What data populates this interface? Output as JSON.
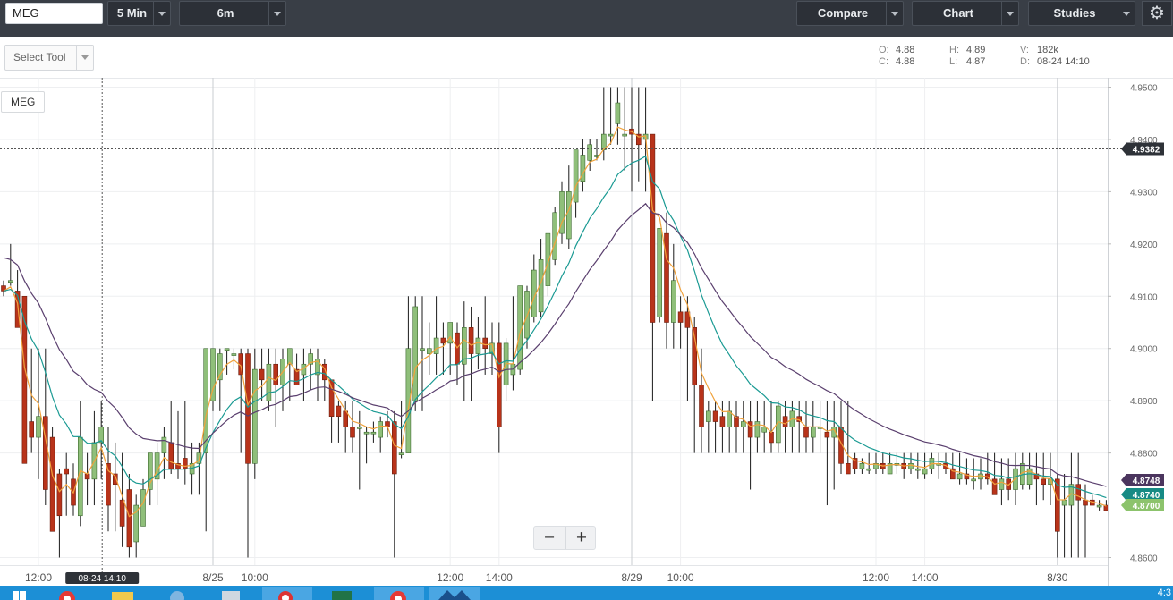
{
  "toolbar": {
    "symbol_value": "MEG",
    "interval": "5 Min",
    "range": "6m",
    "compare": "Compare",
    "chart": "Chart",
    "studies": "Studies",
    "settings_icon": "gear-icon"
  },
  "subbar": {
    "select_tool": "Select Tool",
    "ohlc": {
      "o_label": "O:",
      "o": "4.88",
      "c_label": "C:",
      "c": "4.88",
      "h_label": "H:",
      "h": "4.89",
      "l_label": "L:",
      "l": "4.87",
      "v_label": "V:",
      "v": "182k",
      "d_label": "D:",
      "d": "08-24 14:10"
    }
  },
  "chart_symbol": "MEG",
  "zoom": {
    "minus": "−",
    "plus": "+"
  },
  "taskbar": {
    "clock": "4:3"
  },
  "colors": {
    "up": "#8fbf7a",
    "down": "#b8331a",
    "ema_fast": "#f0a23c",
    "ema_mid": "#1a9a93",
    "ema_slow": "#5a3f6e",
    "crosshair_label": "#2e3238"
  },
  "chart_data": {
    "type": "candlestick",
    "ylim": [
      4.858,
      4.952
    ],
    "y_ticks": [
      "4.9500",
      "4.9400",
      "4.9300",
      "4.9200",
      "4.9100",
      "4.9000",
      "4.8900",
      "4.8800",
      "4.8600"
    ],
    "x_ticks": [
      {
        "i": 5,
        "label": "12:00"
      },
      {
        "i": 30,
        "label": "8/25"
      },
      {
        "i": 36,
        "label": "10:00"
      },
      {
        "i": 64,
        "label": "12:00"
      },
      {
        "i": 71,
        "label": "14:00"
      },
      {
        "i": 90,
        "label": "8/29"
      },
      {
        "i": 97,
        "label": "10:00"
      },
      {
        "i": 125,
        "label": "12:00"
      },
      {
        "i": 132,
        "label": "14:00"
      },
      {
        "i": 151,
        "label": "8/30"
      }
    ],
    "crosshair": {
      "i": 14,
      "date_label": "08-24 14:10",
      "price": 4.9382,
      "price_label": "4.9382"
    },
    "last_values": [
      {
        "label": "4.8748",
        "value": 4.8748,
        "color": "#4b355e"
      },
      {
        "label": "4.8740",
        "value": 4.873,
        "color": "#178a84"
      },
      {
        "label": "4.8700",
        "value": 4.87,
        "color": "#8cc36c"
      }
    ],
    "candles": [
      [
        4.912,
        4.913,
        4.91,
        4.911
      ],
      [
        4.913,
        4.92,
        4.912,
        4.913
      ],
      [
        4.911,
        4.915,
        4.905,
        4.904
      ],
      [
        4.91,
        4.91,
        4.878,
        4.878
      ],
      [
        4.886,
        4.9,
        4.88,
        4.883
      ],
      [
        4.883,
        4.9,
        4.875,
        4.887
      ],
      [
        4.887,
        4.9,
        4.87,
        4.873
      ],
      [
        4.883,
        4.885,
        4.868,
        4.865
      ],
      [
        4.876,
        4.877,
        4.86,
        4.868
      ],
      [
        4.877,
        4.88,
        4.868,
        4.876
      ],
      [
        4.875,
        4.878,
        4.868,
        4.87
      ],
      [
        4.868,
        4.89,
        4.866,
        4.883
      ],
      [
        4.876,
        4.88,
        4.87,
        4.875
      ],
      [
        4.875,
        4.888,
        4.87,
        4.882
      ],
      [
        4.882,
        4.89,
        4.875,
        4.885
      ],
      [
        4.878,
        4.885,
        4.865,
        4.87
      ],
      [
        4.876,
        4.882,
        4.865,
        4.874
      ],
      [
        4.871,
        4.88,
        4.862,
        4.866
      ],
      [
        4.873,
        4.876,
        4.86,
        4.862
      ],
      [
        4.863,
        4.872,
        4.86,
        4.87
      ],
      [
        4.866,
        4.875,
        4.866,
        4.873
      ],
      [
        4.873,
        4.88,
        4.87,
        4.88
      ],
      [
        4.875,
        4.882,
        4.87,
        4.88
      ],
      [
        4.88,
        4.885,
        4.875,
        4.883
      ],
      [
        4.882,
        4.89,
        4.876,
        4.877
      ],
      [
        4.878,
        4.888,
        4.875,
        4.877
      ],
      [
        4.879,
        4.89,
        4.874,
        4.877
      ],
      [
        4.876,
        4.882,
        4.872,
        4.878
      ],
      [
        4.878,
        4.882,
        4.872,
        4.88
      ],
      [
        4.88,
        4.882,
        4.865,
        4.9
      ],
      [
        4.89,
        4.9,
        4.888,
        4.9
      ],
      [
        4.894,
        4.9,
        4.888,
        4.899
      ],
      [
        4.9,
        4.9,
        4.895,
        4.9
      ],
      [
        4.899,
        4.9,
        4.896,
        4.899
      ],
      [
        4.899,
        4.9,
        4.88,
        4.895
      ],
      [
        4.899,
        4.9,
        4.86,
        4.878
      ],
      [
        4.878,
        4.9,
        4.875,
        4.896
      ],
      [
        4.896,
        4.9,
        4.89,
        4.894
      ],
      [
        4.89,
        4.9,
        4.888,
        4.897
      ],
      [
        4.897,
        4.9,
        4.885,
        4.893
      ],
      [
        4.893,
        4.9,
        4.888,
        4.898
      ],
      [
        4.897,
        4.9,
        4.89,
        4.9
      ],
      [
        4.896,
        4.899,
        4.893,
        4.893
      ],
      [
        4.895,
        4.9,
        4.89,
        4.897
      ],
      [
        4.897,
        4.9,
        4.892,
        4.899
      ],
      [
        4.895,
        4.9,
        4.89,
        4.898
      ],
      [
        4.897,
        4.898,
        4.89,
        4.894
      ],
      [
        4.894,
        4.894,
        4.882,
        4.887
      ],
      [
        4.889,
        4.89,
        4.882,
        4.887
      ],
      [
        4.888,
        4.89,
        4.88,
        4.885
      ],
      [
        4.885,
        4.89,
        4.88,
        4.883
      ],
      [
        4.885,
        4.888,
        4.873,
        4.885
      ],
      [
        4.884,
        4.885,
        4.878,
        4.884
      ],
      [
        4.884,
        4.886,
        4.882,
        4.884
      ],
      [
        4.883,
        4.887,
        4.88,
        4.886
      ],
      [
        4.886,
        4.888,
        4.883,
        4.885
      ],
      [
        4.886,
        4.888,
        4.86,
        4.876
      ],
      [
        4.88,
        4.89,
        4.879,
        4.88
      ],
      [
        4.88,
        4.91,
        4.88,
        4.9
      ],
      [
        4.89,
        4.91,
        4.888,
        4.908
      ],
      [
        4.9,
        4.91,
        4.888,
        4.9
      ],
      [
        4.899,
        4.905,
        4.895,
        4.9
      ],
      [
        4.899,
        4.91,
        4.895,
        4.902
      ],
      [
        4.902,
        4.905,
        4.895,
        4.901
      ],
      [
        4.901,
        4.905,
        4.895,
        4.905
      ],
      [
        4.903,
        4.905,
        4.893,
        4.897
      ],
      [
        4.897,
        4.909,
        4.89,
        4.904
      ],
      [
        4.904,
        4.908,
        4.89,
        4.899
      ],
      [
        4.899,
        4.906,
        4.896,
        4.902
      ],
      [
        4.902,
        4.91,
        4.895,
        4.9
      ],
      [
        4.899,
        4.905,
        4.895,
        4.901
      ],
      [
        4.901,
        4.905,
        4.88,
        4.885
      ],
      [
        4.893,
        4.902,
        4.89,
        4.901
      ],
      [
        4.895,
        4.91,
        4.892,
        4.897
      ],
      [
        4.896,
        4.912,
        4.895,
        4.912
      ],
      [
        4.902,
        4.912,
        4.9,
        4.911
      ],
      [
        4.906,
        4.918,
        4.905,
        4.915
      ],
      [
        4.907,
        4.921,
        4.906,
        4.917
      ],
      [
        4.912,
        4.92,
        4.91,
        4.922
      ],
      [
        4.917,
        4.927,
        4.916,
        4.926
      ],
      [
        4.922,
        4.932,
        4.92,
        4.93
      ],
      [
        4.921,
        4.935,
        4.919,
        4.93
      ],
      [
        4.928,
        4.938,
        4.925,
        4.938
      ],
      [
        4.932,
        4.94,
        4.93,
        4.937
      ],
      [
        4.936,
        4.94,
        4.934,
        4.939
      ],
      [
        4.937,
        4.94,
        4.936,
        4.937
      ],
      [
        4.938,
        4.95,
        4.936,
        4.941
      ],
      [
        4.941,
        4.95,
        4.939,
        4.941
      ],
      [
        4.943,
        4.95,
        4.939,
        4.947
      ],
      [
        4.941,
        4.95,
        4.934,
        4.941
      ],
      [
        4.942,
        4.95,
        4.93,
        4.941
      ],
      [
        4.941,
        4.95,
        4.932,
        4.939
      ],
      [
        4.94,
        4.95,
        4.93,
        4.941
      ],
      [
        4.941,
        4.941,
        4.89,
        4.905
      ],
      [
        4.906,
        4.915,
        4.905,
        4.923
      ],
      [
        4.922,
        4.926,
        4.9,
        4.905
      ],
      [
        4.905,
        4.92,
        4.9,
        4.913
      ],
      [
        4.907,
        4.91,
        4.9,
        4.905
      ],
      [
        4.907,
        4.91,
        4.89,
        4.904
      ],
      [
        4.904,
        4.906,
        4.88,
        4.893
      ],
      [
        4.893,
        4.9,
        4.88,
        4.885
      ],
      [
        4.886,
        4.89,
        4.88,
        4.888
      ],
      [
        4.888,
        4.89,
        4.88,
        4.886
      ],
      [
        4.887,
        4.89,
        4.88,
        4.885
      ],
      [
        4.885,
        4.89,
        4.88,
        4.888
      ],
      [
        4.887,
        4.89,
        4.88,
        4.885
      ],
      [
        4.885,
        4.89,
        4.88,
        4.886
      ],
      [
        4.886,
        4.89,
        4.873,
        4.883
      ],
      [
        4.883,
        4.89,
        4.88,
        4.886
      ],
      [
        4.884,
        4.89,
        4.88,
        4.885
      ],
      [
        4.884,
        4.89,
        4.88,
        4.882
      ],
      [
        4.882,
        4.89,
        4.88,
        4.889
      ],
      [
        4.887,
        4.89,
        4.88,
        4.885
      ],
      [
        4.885,
        4.89,
        4.88,
        4.888
      ],
      [
        4.887,
        4.89,
        4.88,
        4.886
      ],
      [
        4.885,
        4.89,
        4.88,
        4.883
      ],
      [
        4.883,
        4.89,
        4.88,
        4.885
      ],
      [
        4.885,
        4.89,
        4.88,
        4.885
      ],
      [
        4.884,
        4.89,
        4.87,
        4.883
      ],
      [
        4.883,
        4.89,
        4.873,
        4.885
      ],
      [
        4.885,
        4.89,
        4.876,
        4.878
      ],
      [
        4.878,
        4.89,
        4.876,
        4.876
      ],
      [
        4.879,
        4.88,
        4.876,
        4.877
      ],
      [
        4.877,
        4.879,
        4.876,
        4.878
      ],
      [
        4.877,
        4.88,
        4.876,
        4.877
      ],
      [
        4.877,
        4.88,
        4.876,
        4.878
      ],
      [
        4.878,
        4.88,
        4.876,
        4.877
      ],
      [
        4.876,
        4.88,
        4.876,
        4.878
      ],
      [
        4.878,
        4.88,
        4.876,
        4.878
      ],
      [
        4.878,
        4.88,
        4.875,
        4.877
      ],
      [
        4.877,
        4.88,
        4.876,
        4.878
      ],
      [
        4.877,
        4.88,
        4.875,
        4.877
      ],
      [
        4.876,
        4.88,
        4.875,
        4.877
      ],
      [
        4.877,
        4.88,
        4.876,
        4.879
      ],
      [
        4.878,
        4.88,
        4.875,
        4.878
      ],
      [
        4.878,
        4.88,
        4.876,
        4.877
      ],
      [
        4.877,
        4.88,
        4.875,
        4.875
      ],
      [
        4.875,
        4.88,
        4.874,
        4.876
      ],
      [
        4.876,
        4.879,
        4.874,
        4.875
      ],
      [
        4.875,
        4.879,
        4.873,
        4.875
      ],
      [
        4.875,
        4.879,
        4.873,
        4.876
      ],
      [
        4.876,
        4.88,
        4.874,
        4.875
      ],
      [
        4.875,
        4.88,
        4.873,
        4.872
      ],
      [
        4.873,
        4.879,
        4.87,
        4.875
      ],
      [
        4.875,
        4.879,
        4.871,
        4.873
      ],
      [
        4.873,
        4.88,
        4.87,
        4.877
      ],
      [
        4.874,
        4.88,
        4.873,
        4.878
      ],
      [
        4.874,
        4.88,
        4.873,
        4.877
      ],
      [
        4.876,
        4.88,
        4.87,
        4.875
      ],
      [
        4.875,
        4.88,
        4.871,
        4.874
      ],
      [
        4.874,
        4.88,
        4.87,
        4.875
      ],
      [
        4.875,
        4.876,
        4.86,
        4.865
      ],
      [
        4.87,
        4.876,
        4.86,
        4.871
      ],
      [
        4.87,
        4.88,
        4.86,
        4.874
      ],
      [
        4.874,
        4.88,
        4.86,
        4.871
      ],
      [
        4.871,
        4.874,
        4.86,
        4.87
      ],
      [
        4.871,
        4.872,
        4.87,
        4.87
      ],
      [
        4.87,
        4.871,
        4.869,
        4.87
      ],
      [
        4.87,
        4.871,
        4.869,
        4.869
      ]
    ]
  }
}
